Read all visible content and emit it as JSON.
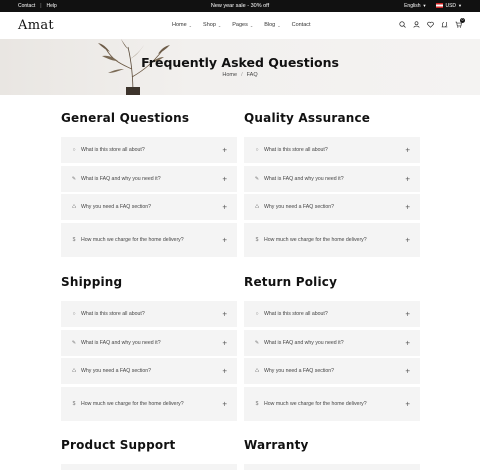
{
  "topbar": {
    "links": [
      "Contact",
      "Help"
    ],
    "sep": "|",
    "announcement": "New year sale - 30% off",
    "language": "English",
    "currency": "USD"
  },
  "header": {
    "logo": "Amat",
    "nav": [
      "Home",
      "Shop",
      "Pages",
      "Blog",
      "Contact"
    ],
    "cart_count": "0"
  },
  "hero": {
    "title": "Frequently Asked Questions",
    "breadcrumb_home": "Home",
    "breadcrumb_sep": "/",
    "breadcrumb_current": "FAQ"
  },
  "icons": {
    "q1": "circle-icon",
    "q2": "pencil-icon",
    "q3": "recycle-icon",
    "q4": "dollar-icon"
  },
  "sections": [
    {
      "title": "General Questions",
      "questions": [
        "What is this store all about?",
        "What is FAQ and why you need it?",
        "Why you need a FAQ section?",
        "How much we charge for the home delivery?"
      ]
    },
    {
      "title": "Quality Assurance",
      "questions": [
        "What is this store all about?",
        "What is FAQ and why you need it?",
        "Why you need a FAQ section?",
        "How much we charge for the home delivery?"
      ]
    },
    {
      "title": "Shipping",
      "questions": [
        "What is this store all about?",
        "What is FAQ and why you need it?",
        "Why you need a FAQ section?",
        "How much we charge for the home delivery?"
      ]
    },
    {
      "title": "Return Policy",
      "questions": [
        "What is this store all about?",
        "What is FAQ and why you need it?",
        "Why you need a FAQ section?",
        "How much we charge for the home delivery?"
      ]
    },
    {
      "title": "Product Support"
    },
    {
      "title": "Warranty"
    }
  ]
}
